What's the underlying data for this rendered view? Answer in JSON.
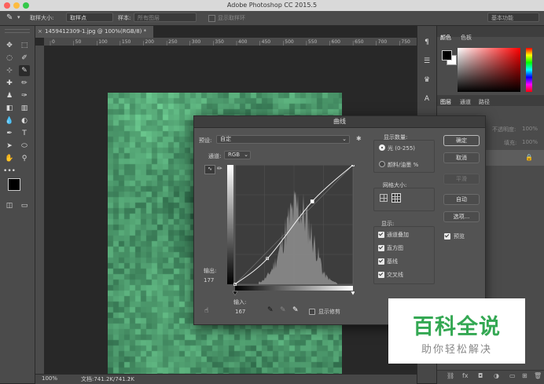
{
  "window": {
    "title": "Adobe Photoshop CC 2015.5"
  },
  "options_bar": {
    "sample_size_label": "取样大小:",
    "sample_size_value": "取样点",
    "sample_label": "样本:",
    "sample_value": "所有图层",
    "show_ring_label": "显示取样环",
    "workspace": "基本功能"
  },
  "document": {
    "tab_title": "1459412309-1.jpg @ 100%(RGB/8) *",
    "ruler_ticks": [
      "0",
      "50",
      "100",
      "150",
      "200",
      "250",
      "300",
      "350",
      "400",
      "450",
      "500",
      "550",
      "600",
      "650",
      "700",
      "750"
    ]
  },
  "status": {
    "zoom": "100%",
    "doc_size": "文档:741.2K/741.2K"
  },
  "panels": {
    "color_tab": "颜色",
    "swatches_tab": "色板",
    "layers_tab": "图层",
    "channels_tab": "通道",
    "paths_tab": "路径",
    "opacity_label": "不透明度:",
    "opacity_value": "100%",
    "fill_label": "填充:",
    "fill_value": "100%"
  },
  "curves_dialog": {
    "title": "曲线",
    "preset_label": "预设:",
    "preset_value": "自定",
    "channel_label": "通道:",
    "channel_value": "RGB",
    "output_label": "输出:",
    "output_value": "177",
    "input_label": "输入:",
    "input_value": "167",
    "show_clipping_label": "显示修剪",
    "show_amount_title": "显示数量:",
    "light_option": "光 (0-255)",
    "pigment_option": "颜料/油墨 %",
    "grid_size_title": "网格大小:",
    "display_title": "显示:",
    "display_options": [
      "通道叠加",
      "直方图",
      "基线",
      "交叉线"
    ],
    "buttons": {
      "ok": "确定",
      "cancel": "取消",
      "smooth": "平滑",
      "auto": "自动",
      "options": "选项..."
    },
    "preview_label": "预览"
  },
  "watermark": {
    "main": "百科全说",
    "sub": "助你轻松解决"
  },
  "colors": {
    "accent_green": "#34a853",
    "image_green": "#3a8a66",
    "dialog_bg": "#535353"
  }
}
